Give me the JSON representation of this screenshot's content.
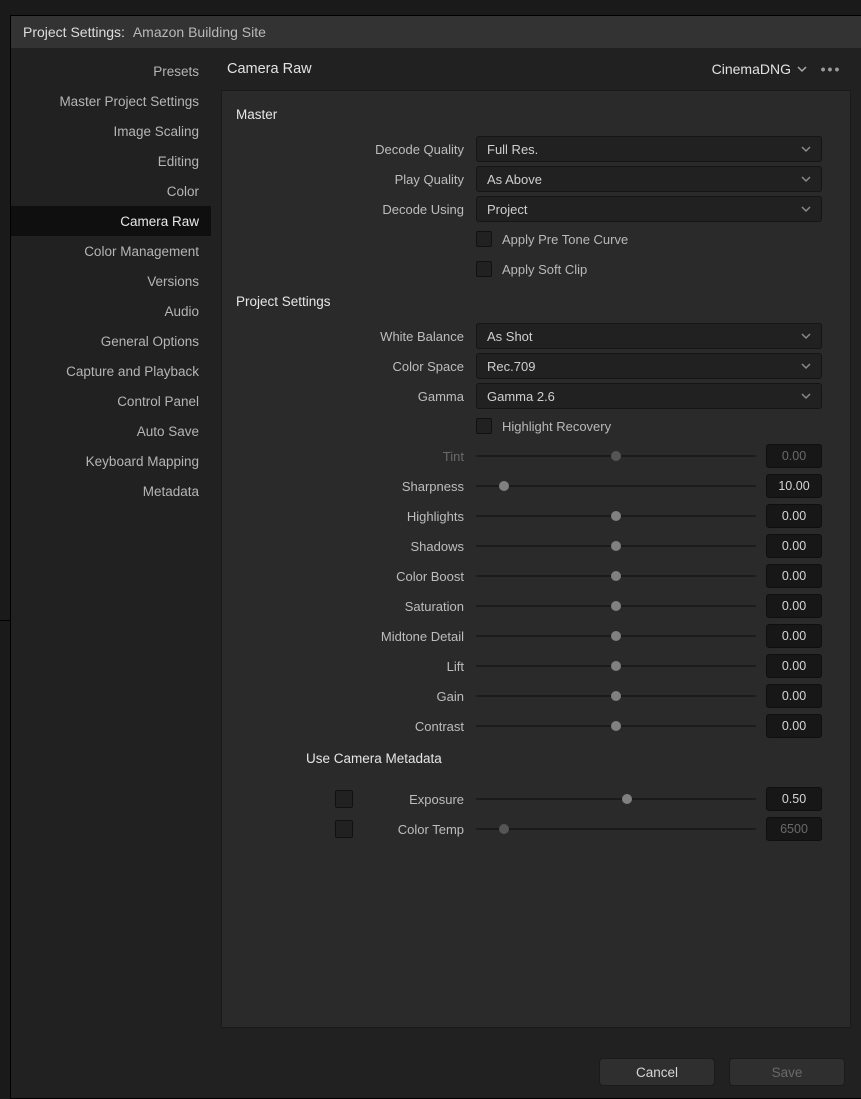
{
  "window": {
    "title_prefix": "Project Settings:",
    "project_name": "Amazon Building Site"
  },
  "sidebar": {
    "items": [
      {
        "label": "Presets"
      },
      {
        "label": "Master Project Settings"
      },
      {
        "label": "Image Scaling"
      },
      {
        "label": "Editing"
      },
      {
        "label": "Color"
      },
      {
        "label": "Camera Raw"
      },
      {
        "label": "Color Management"
      },
      {
        "label": "Versions"
      },
      {
        "label": "Audio"
      },
      {
        "label": "General Options"
      },
      {
        "label": "Capture and Playback"
      },
      {
        "label": "Control Panel"
      },
      {
        "label": "Auto Save"
      },
      {
        "label": "Keyboard Mapping"
      },
      {
        "label": "Metadata"
      }
    ],
    "active_index": 5
  },
  "panel": {
    "title": "Camera Raw",
    "format": "CinemaDNG",
    "sections": {
      "master": {
        "title": "Master",
        "decode_quality": {
          "label": "Decode Quality",
          "value": "Full Res."
        },
        "play_quality": {
          "label": "Play Quality",
          "value": "As Above"
        },
        "decode_using": {
          "label": "Decode Using",
          "value": "Project"
        },
        "apply_pre_tone": {
          "label": "Apply Pre Tone Curve",
          "checked": false
        },
        "apply_soft_clip": {
          "label": "Apply Soft Clip",
          "checked": false
        }
      },
      "project": {
        "title": "Project Settings",
        "white_balance": {
          "label": "White Balance",
          "value": "As Shot"
        },
        "color_space": {
          "label": "Color Space",
          "value": "Rec.709"
        },
        "gamma": {
          "label": "Gamma",
          "value": "Gamma 2.6"
        },
        "highlight_recovery": {
          "label": "Highlight Recovery",
          "checked": false
        },
        "sliders": [
          {
            "label": "Tint",
            "value": "0.00",
            "pos": 50,
            "disabled": true
          },
          {
            "label": "Sharpness",
            "value": "10.00",
            "pos": 10,
            "disabled": false
          },
          {
            "label": "Highlights",
            "value": "0.00",
            "pos": 50,
            "disabled": false
          },
          {
            "label": "Shadows",
            "value": "0.00",
            "pos": 50,
            "disabled": false
          },
          {
            "label": "Color Boost",
            "value": "0.00",
            "pos": 50,
            "disabled": false
          },
          {
            "label": "Saturation",
            "value": "0.00",
            "pos": 50,
            "disabled": false
          },
          {
            "label": "Midtone Detail",
            "value": "0.00",
            "pos": 50,
            "disabled": false
          },
          {
            "label": "Lift",
            "value": "0.00",
            "pos": 50,
            "disabled": false
          },
          {
            "label": "Gain",
            "value": "0.00",
            "pos": 50,
            "disabled": false
          },
          {
            "label": "Contrast",
            "value": "0.00",
            "pos": 50,
            "disabled": false
          }
        ]
      },
      "metadata": {
        "title": "Use Camera Metadata",
        "rows": [
          {
            "label": "Exposure",
            "value": "0.50",
            "pos": 54,
            "checked": false,
            "disabled": false
          },
          {
            "label": "Color Temp",
            "value": "6500",
            "pos": 10,
            "checked": false,
            "disabled": true
          }
        ]
      }
    }
  },
  "footer": {
    "cancel": "Cancel",
    "save": "Save"
  }
}
